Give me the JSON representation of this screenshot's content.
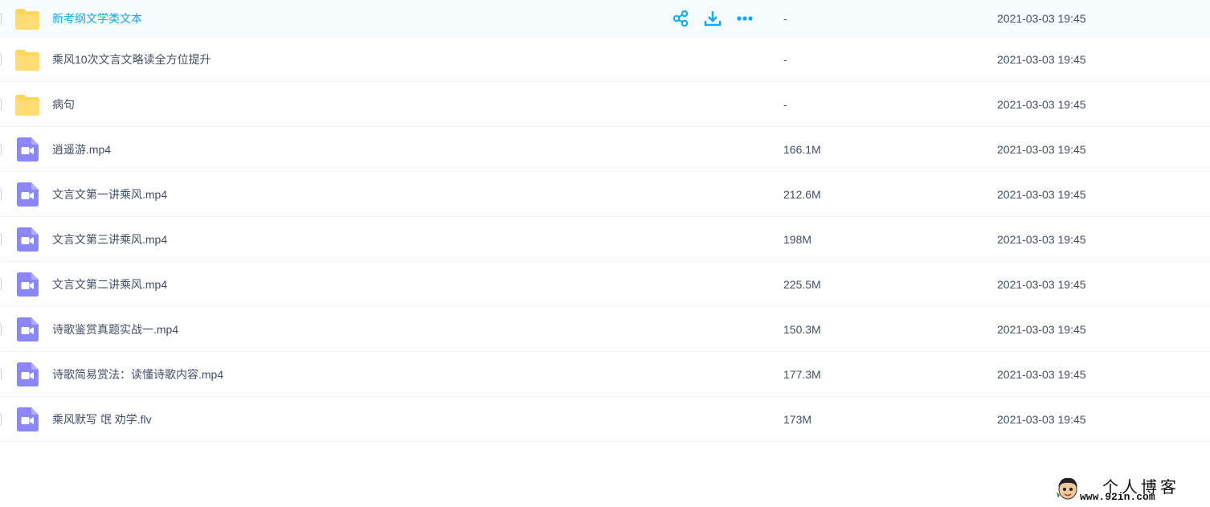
{
  "files": [
    {
      "name": "新考纲文学类文本",
      "size": "-",
      "modified": "2021-03-03 19:45",
      "type": "folder",
      "icon": "folder-icon",
      "hovered": true
    },
    {
      "name": "乘风10次文言文略读全方位提升",
      "size": "-",
      "modified": "2021-03-03 19:45",
      "type": "folder",
      "icon": "folder-icon"
    },
    {
      "name": "病句",
      "size": "-",
      "modified": "2021-03-03 19:45",
      "type": "folder",
      "icon": "folder-icon"
    },
    {
      "name": "逍遥游.mp4",
      "size": "166.1M",
      "modified": "2021-03-03 19:45",
      "type": "video",
      "icon": "video-file-icon"
    },
    {
      "name": "文言文第一讲乘风.mp4",
      "size": "212.6M",
      "modified": "2021-03-03 19:45",
      "type": "video",
      "icon": "video-file-icon"
    },
    {
      "name": "文言文第三讲乘风.mp4",
      "size": "198M",
      "modified": "2021-03-03 19:45",
      "type": "video",
      "icon": "video-file-icon"
    },
    {
      "name": "文言文第二讲乘风.mp4",
      "size": "225.5M",
      "modified": "2021-03-03 19:45",
      "type": "video",
      "icon": "video-file-icon"
    },
    {
      "name": "诗歌鉴赏真题实战一.mp4",
      "size": "150.3M",
      "modified": "2021-03-03 19:45",
      "type": "video",
      "icon": "video-file-icon"
    },
    {
      "name": "诗歌简易赏法：读懂诗歌内容.mp4",
      "size": "177.3M",
      "modified": "2021-03-03 19:45",
      "type": "video",
      "icon": "video-file-icon"
    },
    {
      "name": "乘风默写 氓 劝学.flv",
      "size": "173M",
      "modified": "2021-03-03 19:45",
      "type": "video",
      "icon": "video-file-icon"
    }
  ],
  "hover_actions": [
    "share-icon",
    "download-icon",
    "more-icon"
  ],
  "colors": {
    "accent": "#09aaff",
    "folder": "#ffd659",
    "video": "#8b86f9",
    "hover_bg": "#f6fbff",
    "text": "#424e67"
  },
  "watermark": {
    "title": "个人博客",
    "url": "www.92in.com"
  }
}
